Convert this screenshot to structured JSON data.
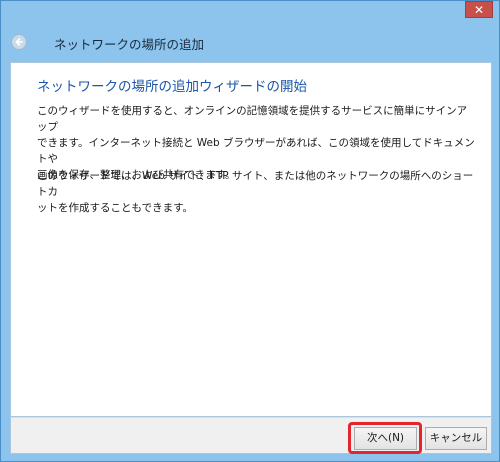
{
  "window": {
    "title": "ネットワークの場所の追加",
    "close_label": "✕"
  },
  "wizard": {
    "heading": "ネットワークの場所の追加ウィザードの開始",
    "paragraph1": "このウィザードを使用すると、オンラインの記憶領域を提供するサービスに簡単にサインアップ\nできます。インターネット接続と Web ブラウザーがあれば、この領域を使用してドキュメントや\n画像を保存、整理、および共有できます。",
    "paragraph2": "このウィザードでは、Web サイト、FTP サイト、または他のネットワークの場所へのショートカ\nットを作成することもできます。"
  },
  "buttons": {
    "next_label": "次へ(N)",
    "cancel_label": "キャンセル"
  },
  "icons": {
    "back": "back-arrow-icon",
    "close": "close-icon"
  },
  "colors": {
    "frame": "#8cc4ee",
    "heading": "#1b56a8",
    "close": "#c7504a",
    "highlight": "#e3262d"
  }
}
